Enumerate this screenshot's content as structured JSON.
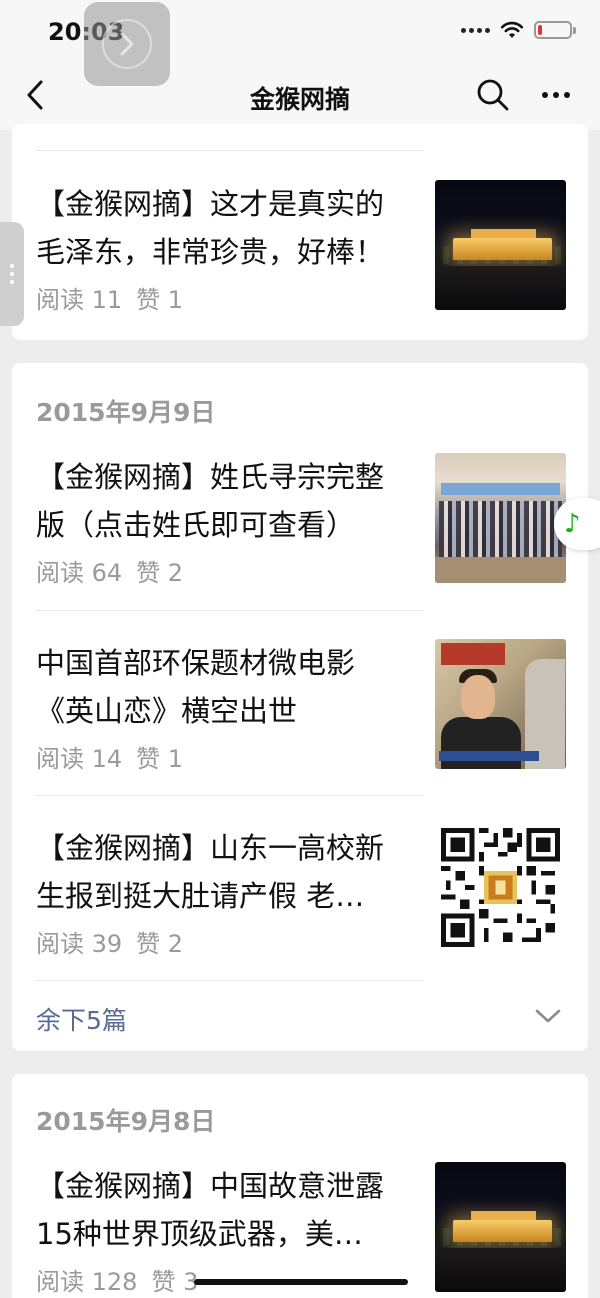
{
  "status_bar": {
    "time": "20:03",
    "battery_level": 0.12,
    "battery_color": "#e33333"
  },
  "nav": {
    "title": "金猴网摘"
  },
  "icons": {
    "back": "chevron-left-icon",
    "search": "search-icon",
    "more": "more-dots-icon",
    "music": "music-note-icon",
    "forward": "chevron-right-icon",
    "expand": "chevron-down-icon"
  },
  "music_glyph": "♪",
  "cards": [
    {
      "articles": [
        {
          "title": "【金猴网摘】这才是真实的毛泽东，非常珍贵，好棒！",
          "reads": "阅读 11",
          "likes": "赞 1",
          "thumb": "night-palace"
        }
      ]
    },
    {
      "date": "2015年9月9日",
      "articles": [
        {
          "title": "【金猴网摘】姓氏寻宗完整版（点击姓氏即可查看）",
          "reads": "阅读 64",
          "likes": "赞 2",
          "thumb": "group-photo"
        },
        {
          "title": "中国首部环保题材微电影《英山恋》横空出世",
          "reads": "阅读 14",
          "likes": "赞 1",
          "thumb": "interview"
        },
        {
          "title": "【金猴网摘】山东一高校新生报到挺大肚请产假 老…",
          "reads": "阅读 39",
          "likes": "赞 2",
          "thumb": "qr-code"
        }
      ],
      "more_label": "余下5篇"
    },
    {
      "date": "2015年9月8日",
      "articles": [
        {
          "title": "【金猴网摘】中国故意泄露15种世界顶级武器，美…",
          "reads": "阅读 128",
          "likes": "赞 3",
          "thumb": "night-palace"
        }
      ]
    }
  ],
  "colors": {
    "link": "#576b95",
    "meta": "#9a9a9a",
    "background": "#ededed",
    "music": "#1aad19"
  }
}
